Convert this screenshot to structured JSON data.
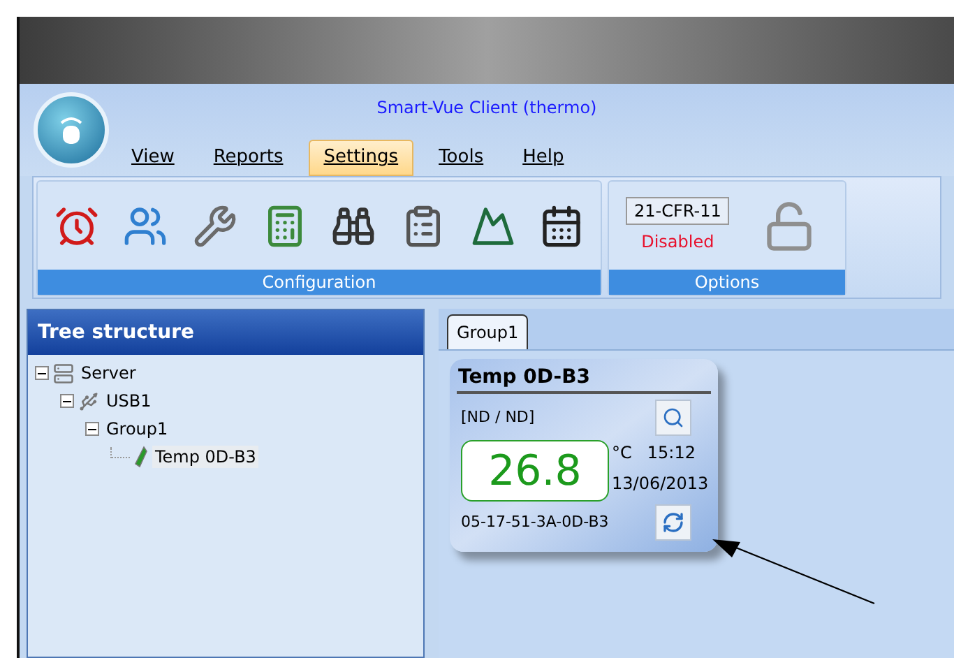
{
  "window": {
    "title": "Smart-Vue Client (thermo)"
  },
  "menu": [
    {
      "label": "View",
      "selected": false
    },
    {
      "label": "Reports",
      "selected": false
    },
    {
      "label": "Settings",
      "selected": true
    },
    {
      "label": "Tools",
      "selected": false
    },
    {
      "label": "Help",
      "selected": false
    }
  ],
  "ribbon": {
    "groups": [
      {
        "label": "Configuration"
      },
      {
        "label": "Options",
        "cfr_button": "21-CFR-11",
        "cfr_status": "Disabled"
      }
    ]
  },
  "tree": {
    "title": "Tree structure",
    "items": [
      {
        "label": "Server",
        "kind": "server",
        "expanded": true,
        "selected": false,
        "children": [
          {
            "label": "USB1",
            "kind": "usb",
            "expanded": true,
            "selected": false,
            "children": [
              {
                "label": "Group1",
                "expanded": true,
                "selected": false,
                "children": [
                  {
                    "label": "Temp 0D-B3",
                    "kind": "sensor",
                    "selected": true
                  }
                ]
              }
            ]
          }
        ]
      }
    ]
  },
  "tabs": [
    {
      "label": "Group1",
      "selected": true
    }
  ],
  "sensor_card": {
    "title": "Temp 0D-B3",
    "range": "[ND / ND]",
    "value": "26.8",
    "unit": "°C",
    "time": "15:12",
    "date": "13/06/2013",
    "serial": "05-17-51-3A-0D-B3"
  }
}
